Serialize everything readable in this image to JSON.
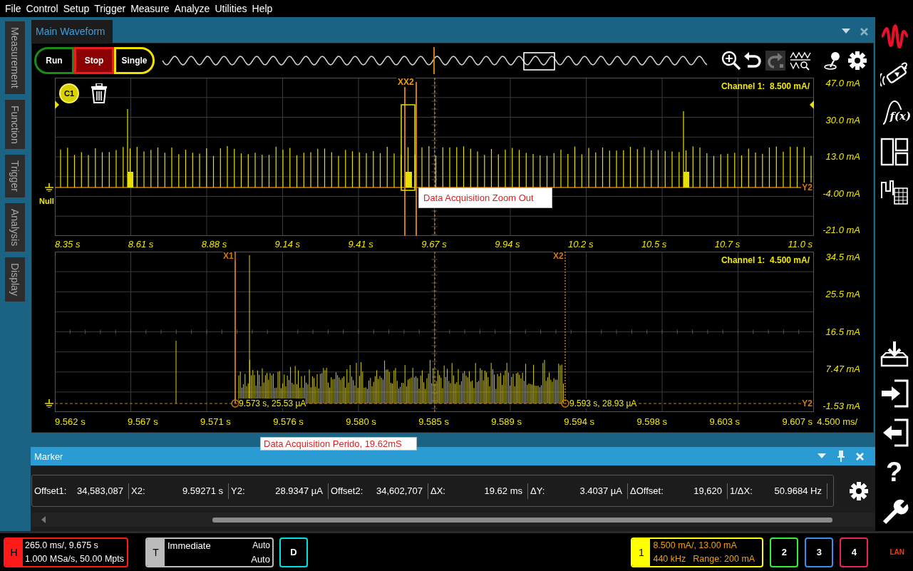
{
  "menu_bar": [
    "File",
    "Control",
    "Setup",
    "Trigger",
    "Measure",
    "Analyze",
    "Utilities",
    "Help"
  ],
  "side_tabs": [
    "Measurement",
    "Function",
    "Trigger",
    "Analysis",
    "Display"
  ],
  "window_tab": {
    "title": "Main Waveform"
  },
  "acquisition_buttons": [
    {
      "label": "Run",
      "kind": "run",
      "selected": false
    },
    {
      "label": "Stop",
      "kind": "stop",
      "selected": true
    },
    {
      "label": "Single",
      "kind": "single",
      "selected": false
    }
  ],
  "history": {
    "undo_disabled": false,
    "redo_disabled": true
  },
  "upper_graph": {
    "badge": "C1",
    "channel_label": "Channel 1:  8.500 mA/",
    "cursor_label": "XX2",
    "ground_label": "Null",
    "y_cursor_label": "Y2",
    "y_labels": [
      "47.0 mA",
      "30.0 mA",
      "13.0 mA",
      "-4.00 mA",
      "-21.0 mA"
    ],
    "x_labels": [
      "8.35 s",
      "8.61 s",
      "8.88 s",
      "9.14 s",
      "9.41 s",
      "9.67 s",
      "9.94 s",
      "10.2 s",
      "10.5 s",
      "10.7 s",
      "11.0 s"
    ]
  },
  "lower_graph": {
    "channel_label": "Channel 1:  4.500 mA/",
    "y_cursor_label": "Y2",
    "x_scale": "4.500 ms/",
    "cursors": [
      {
        "label": "X1",
        "readout": "9.573 s, 25.53 µA"
      },
      {
        "label": "X2",
        "readout": "9.593 s, 28.93 µA"
      }
    ],
    "y_labels": [
      "34.5 mA",
      "25.5 mA",
      "16.5 mA",
      "7.47 mA",
      "-1.53 mA"
    ],
    "x_labels": [
      "9.562 s",
      "9.567 s",
      "9.571 s",
      "9.576 s",
      "9.580 s",
      "9.585 s",
      "9.589 s",
      "9.594 s",
      "9.598 s",
      "9.603 s",
      "9.607 s"
    ]
  },
  "annotations": [
    "Data Acquisition Zoom Out",
    "Data Acquisition Perido, 19.62mS"
  ],
  "marker_panel": {
    "title": "Marker",
    "fields": [
      {
        "label": "Offset1:",
        "value": "34,583,087"
      },
      {
        "label": "X2:",
        "value": "9.59271 s"
      },
      {
        "label": "Y2:",
        "value": "28.9347 µA"
      },
      {
        "label": "Offset2:",
        "value": "34,602,707"
      },
      {
        "label": "ΔX:",
        "value": "19.62 ms"
      },
      {
        "label": "ΔY:",
        "value": "3.4037 µA"
      },
      {
        "label": "ΔOffset:",
        "value": "19,620"
      },
      {
        "label": "1/ΔX:",
        "value": "50.9684 Hz"
      }
    ]
  },
  "right_toolbar": {
    "function_label": "f(x)",
    "help_label": "?"
  },
  "status_bar": {
    "horizontal": {
      "key": "H",
      "line1": "265.0 ms/, 9.675 s",
      "line2": "1.000 MSa/s, 50.00 Mpts"
    },
    "trigger": {
      "key": "T",
      "mode": "Immediate",
      "line1": "Auto",
      "line2": "Auto"
    },
    "digital": {
      "key": "D"
    },
    "channels": [
      {
        "key": "1",
        "on": true,
        "color": "#ffff00",
        "line1": "8.500 mA/, 13.00 mA",
        "bandwidth": "440 kHz",
        "range": "Range: 200 mA"
      },
      {
        "key": "2",
        "on": false,
        "color": "#33ee33"
      },
      {
        "key": "3",
        "on": false,
        "color": "#3b8cf0"
      },
      {
        "key": "4",
        "on": false,
        "color": "#ee2255"
      }
    ],
    "network": "LAN"
  }
}
